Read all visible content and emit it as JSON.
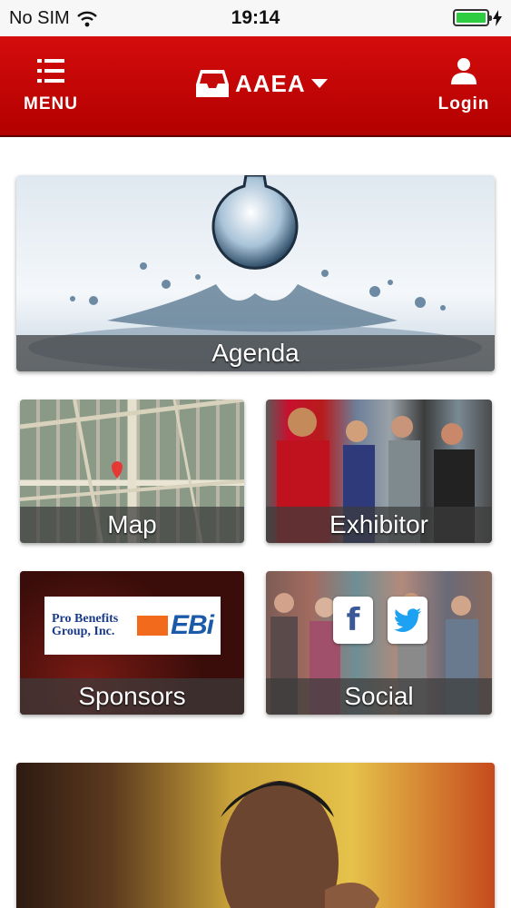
{
  "status_bar": {
    "carrier": "No SIM",
    "time": "19:14",
    "battery_color": "#2ecc40"
  },
  "header": {
    "menu_label": "MENU",
    "menu_icon": "menu-icon",
    "brand": "AAEA",
    "brand_icon": "inbox-icon",
    "dropdown_icon": "caret-down-icon",
    "login_label": "Login",
    "login_icon": "user-icon",
    "background": "#c50a0a"
  },
  "tiles": {
    "agenda": "Agenda",
    "map": "Map",
    "exhibitor": "Exhibitor",
    "sponsors": "Sponsors",
    "social": "Social"
  },
  "sponsors_banner": {
    "pro_benefits_line1": "Pro Benefits",
    "pro_benefits_line2": "Group, Inc.",
    "ebi": "EBi"
  },
  "social_icons": [
    "facebook-icon",
    "twitter-icon"
  ]
}
